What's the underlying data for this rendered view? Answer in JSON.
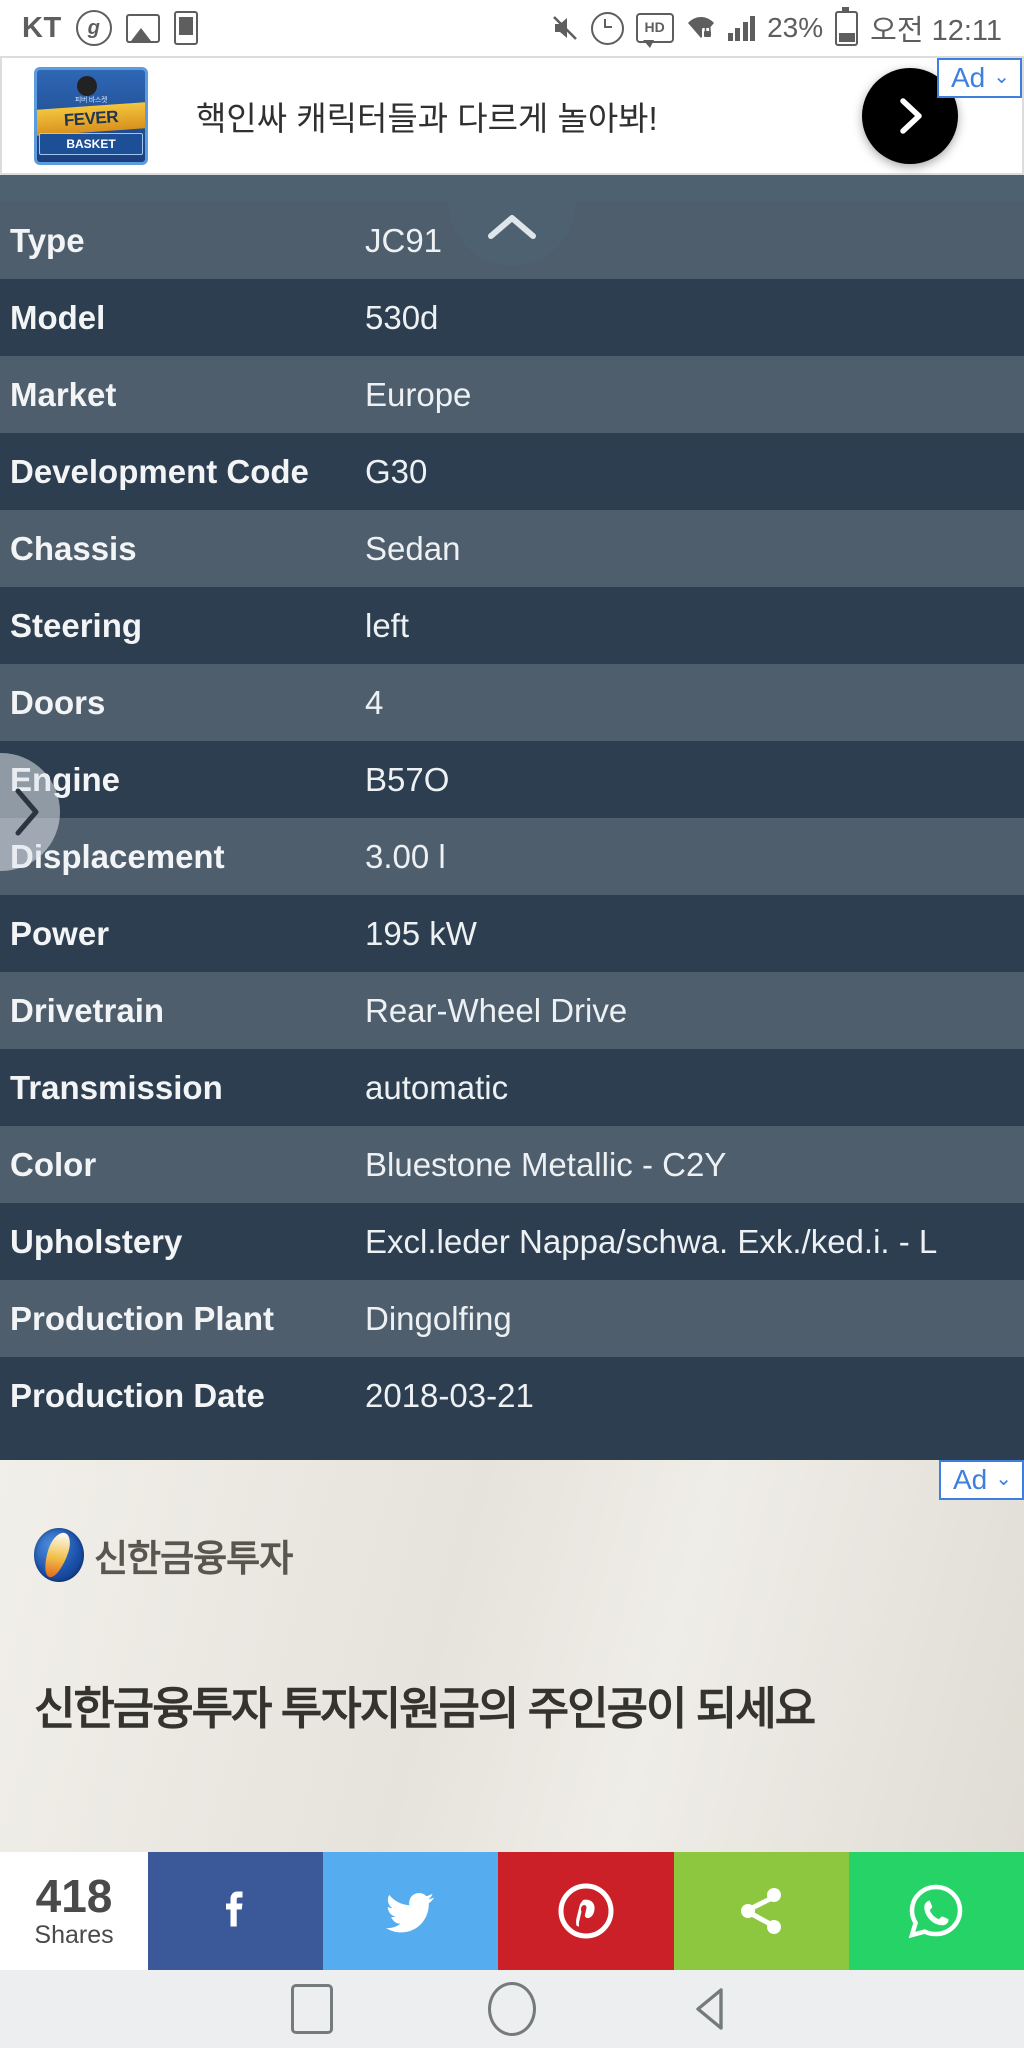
{
  "status_bar": {
    "carrier": "KT",
    "network_badge": "g",
    "icons": [
      "photo-icon",
      "sim-card-icon",
      "mute-icon",
      "alarm-icon",
      "hd-icon",
      "wifi-vpn-icon",
      "signal-bars-icon"
    ],
    "battery_percent": "23%",
    "clock": "오전 12:11"
  },
  "top_ad": {
    "badge_label": "Ad",
    "badge_chevron": "⌄",
    "logo_top": "FEVER",
    "logo_bottom": "BASKET",
    "logo_tagline": "피버 바스켓",
    "headline": "핵인싸 캐릭터들과 다르게 놀아봐!",
    "cta_icon": "chevron-right-icon"
  },
  "spec_sheet": {
    "collapse_icon": "chevron-up-icon",
    "drawer_icon": "chevron-right-icon",
    "rows": [
      {
        "key": "Type",
        "value": "JC91"
      },
      {
        "key": "Model",
        "value": "530d"
      },
      {
        "key": "Market",
        "value": "Europe"
      },
      {
        "key": "Development Code",
        "value": "G30"
      },
      {
        "key": "Chassis",
        "value": "Sedan"
      },
      {
        "key": "Steering",
        "value": "left"
      },
      {
        "key": "Doors",
        "value": "4"
      },
      {
        "key": "Engine",
        "value": "B57O"
      },
      {
        "key": "Displacement",
        "value": "3.00 l"
      },
      {
        "key": "Power",
        "value": "195 kW"
      },
      {
        "key": "Drivetrain",
        "value": "Rear-Wheel Drive"
      },
      {
        "key": "Transmission",
        "value": "automatic"
      },
      {
        "key": "Color",
        "value": "Bluestone Metallic - C2Y"
      },
      {
        "key": "Upholstery",
        "value": "Excl.leder Nappa/schwa. Exk./ked.i. - L"
      },
      {
        "key": "Production Plant",
        "value": "Dingolfing"
      },
      {
        "key": "Production Date",
        "value": "2018-03-21"
      }
    ]
  },
  "bottom_ad": {
    "badge_label": "Ad",
    "badge_chevron": "⌄",
    "advertiser": "신한금융투자",
    "headline": "신한금융투자 투자지원금의 주인공이 되세요"
  },
  "share_bar": {
    "count": "418",
    "count_label": "Shares",
    "buttons": [
      {
        "name": "facebook",
        "glyph": "f",
        "color": "#3b5998"
      },
      {
        "name": "twitter",
        "glyph": "twitter",
        "color": "#55acee"
      },
      {
        "name": "pinterest",
        "glyph": "pinterest",
        "color": "#cb2027"
      },
      {
        "name": "share",
        "glyph": "share",
        "color": "#8dc63f"
      },
      {
        "name": "whatsapp",
        "glyph": "whatsapp",
        "color": "#25d366"
      }
    ]
  },
  "nav_bar": {
    "recents": "recents-square-icon",
    "home": "home-circle-icon",
    "back": "back-triangle-icon"
  },
  "colors": {
    "row_odd": "#4e5e6d",
    "row_even": "#2c3e4f",
    "sheet_bg": "#2e3f50",
    "notch": "#4e6170",
    "ad_blue": "#3f7fe0"
  }
}
